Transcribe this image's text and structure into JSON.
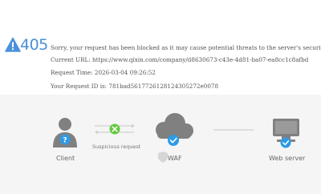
{
  "error": {
    "code": "405",
    "message": "Sorry, your request has been blocked as it may cause potential threats to the server's security.",
    "current_url_label": "Current URL:",
    "current_url": "https://www.qixin.com/company/d8630673-c43e-4d81-ba07-ea8cc1c8afbd",
    "request_time_label": "Request Time:",
    "request_time": "2026-03-04 09:26:52",
    "request_id_label": "Your Request ID is:",
    "request_id": "781bad5617726128124305272e0078"
  },
  "diagram": {
    "client_label": "Client",
    "flow_label": "Suspicious request",
    "waf_label": "WAF",
    "server_label": "Web server"
  },
  "colors": {
    "accent": "#4a90d9",
    "check": "#2e9be6",
    "blocked": "#64c83c",
    "icon_gray": "#808080"
  }
}
